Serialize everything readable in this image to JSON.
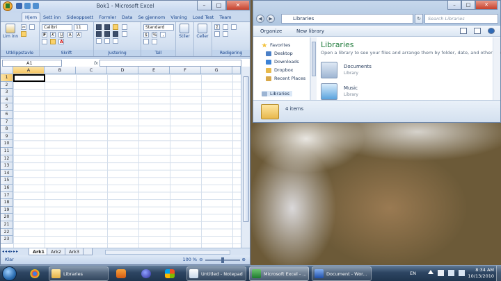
{
  "excel": {
    "title": "Bok1 - Microsoft Excel",
    "tabs": [
      "Hjem",
      "Sett inn",
      "Sideoppsett",
      "Formler",
      "Data",
      "Se gjennom",
      "Visning",
      "Load Test",
      "Team"
    ],
    "groups": {
      "clipboard": "Utklippstavle",
      "font": "Skrift",
      "alignment": "Justering",
      "number": "Tall",
      "styles": "Stiler",
      "cells": "Celler",
      "editing": "Redigering"
    },
    "paste_label": "Lim inn",
    "font_name": "Calibri",
    "font_size": "11",
    "number_format": "Standard",
    "styles_label": "Stiler",
    "cells_label": "Celler",
    "name_box": "A1",
    "fx": "fx",
    "columns": [
      "A",
      "B",
      "C",
      "D",
      "E",
      "F",
      "G"
    ],
    "rows": [
      "1",
      "2",
      "3",
      "4",
      "5",
      "6",
      "7",
      "8",
      "9",
      "10",
      "11",
      "12",
      "13",
      "14",
      "15",
      "16",
      "17",
      "18",
      "19",
      "20",
      "21",
      "22",
      "23"
    ],
    "sheets": [
      "Ark1",
      "Ark2",
      "Ark3"
    ],
    "status": "Klar",
    "zoom": "100 %"
  },
  "explorer": {
    "address": "Libraries",
    "search_placeholder": "Search Libraries",
    "organize": "Organize",
    "new_library": "New library",
    "nav": {
      "favorites": "Favorites",
      "items": [
        "Desktop",
        "Downloads",
        "Dropbox",
        "Recent Places"
      ],
      "libraries": "Libraries"
    },
    "heading": "Libraries",
    "description": "Open a library to see your files and arrange them by folder, date, and other pro...",
    "libraries": [
      {
        "name": "Documents",
        "type": "Library"
      },
      {
        "name": "Music",
        "type": "Library"
      }
    ],
    "item_count": "4 items"
  },
  "taskbar": {
    "buttons": [
      {
        "label": "Libraries",
        "active": false
      },
      {
        "label": "Untitled - Notepad",
        "active": false
      },
      {
        "label": "Microsoft Excel - ...",
        "active": true
      },
      {
        "label": "Document - Wor...",
        "active": false
      }
    ],
    "lang": "EN",
    "time": "8:34 AM",
    "date": "10/13/2010"
  },
  "colors": {
    "excel_chrome": "#c9d9ee",
    "excel_green": "#1e7a3a",
    "selected_header": "#f8c560",
    "taskbar": "#2d4562"
  }
}
